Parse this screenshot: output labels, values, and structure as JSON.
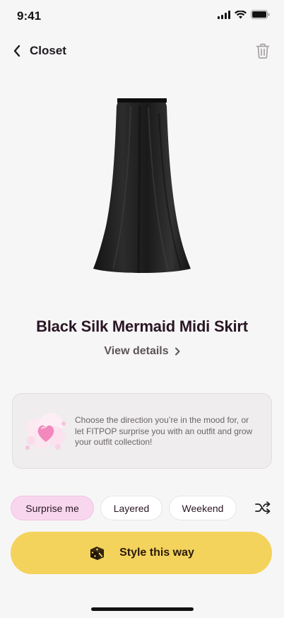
{
  "status": {
    "time": "9:41"
  },
  "nav": {
    "back_label": "Closet"
  },
  "product": {
    "title": "Black Silk Mermaid Midi Skirt",
    "view_details_label": "View details"
  },
  "info_card": {
    "text": "Choose the direction you’re in the mood for, or let FITPOP surprise you with an outfit and grow your outfit collection!"
  },
  "chips": [
    {
      "label": "Surprise me",
      "active": true
    },
    {
      "label": "Layered",
      "active": false
    },
    {
      "label": "Weekend",
      "active": false
    }
  ],
  "cta": {
    "label": "Style this way"
  },
  "colors": {
    "background": "#f7f6f6",
    "accent_yellow": "#f4d35c",
    "chip_active_pink": "#f8d7ee",
    "title_text": "#2a1624"
  },
  "icons": {
    "back": "chevron-left-icon",
    "trash": "trash-icon",
    "view_details": "chevron-right-icon",
    "shuffle": "shuffle-icon",
    "cta": "dice-icon",
    "info": "heart-cloud-icon"
  }
}
